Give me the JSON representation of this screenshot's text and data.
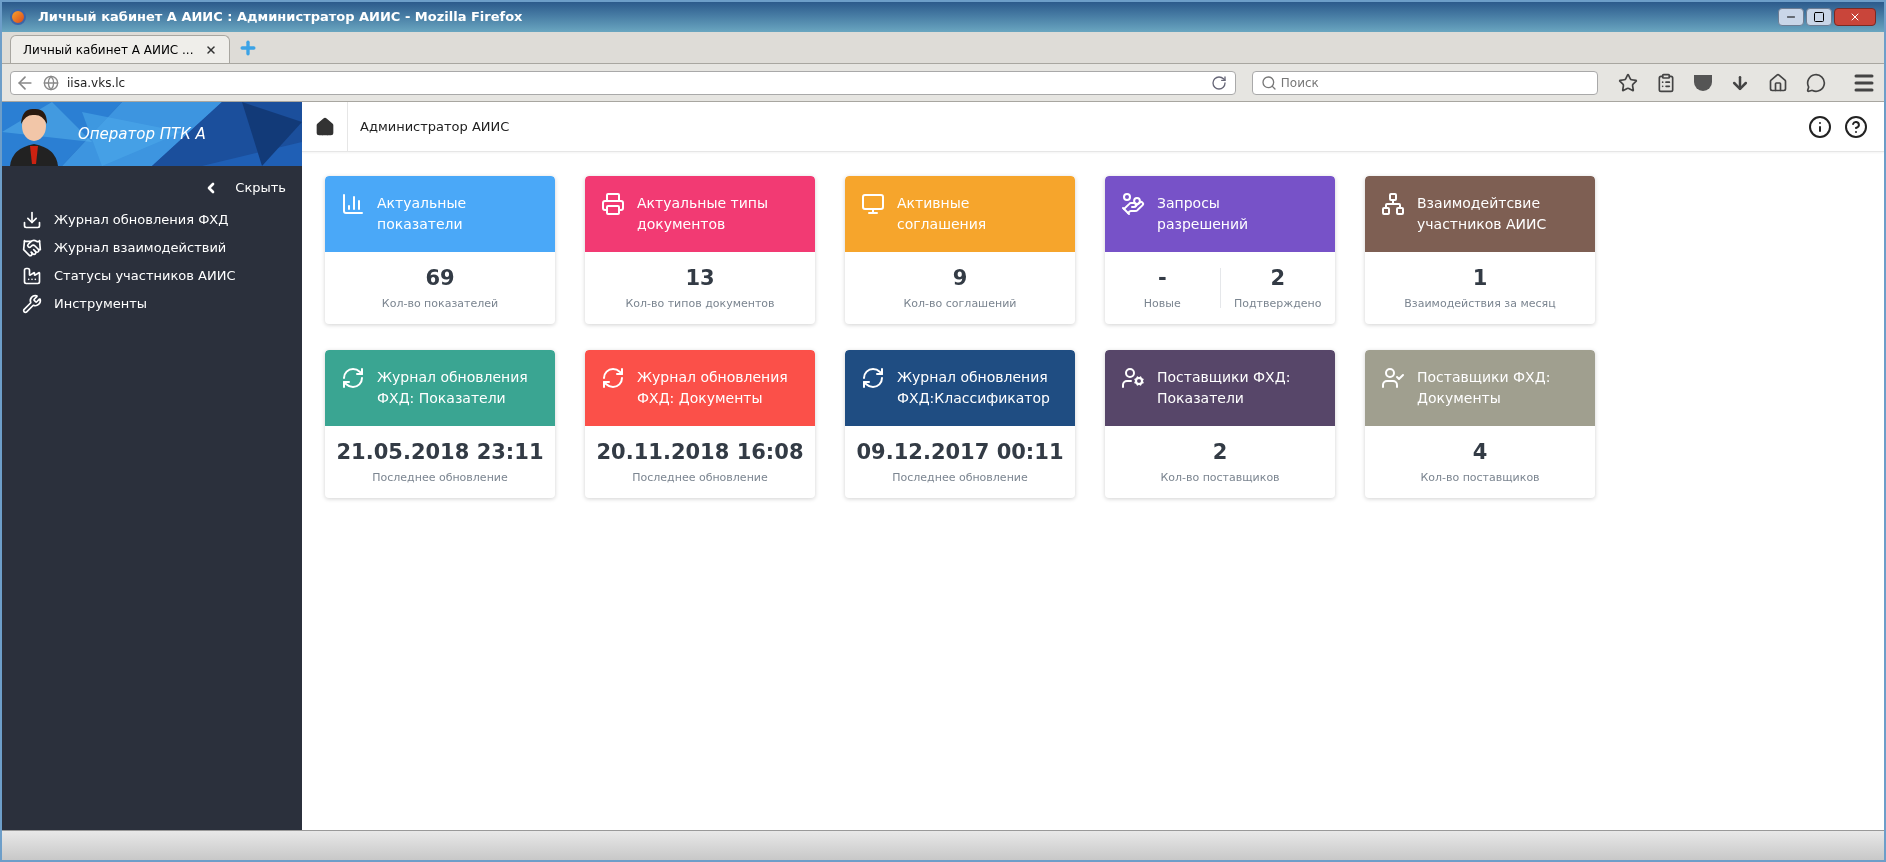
{
  "window": {
    "title": "Личный кабинет А АИИС : Администратор АИИС - Mozilla Firefox"
  },
  "tabs": [
    {
      "label": "Личный кабинет А АИИС ...",
      "selected": true
    }
  ],
  "address_bar": {
    "value": "iisa.vks.lc"
  },
  "search": {
    "placeholder": "Поиск"
  },
  "sidebar": {
    "user": "Оператор ПТК А",
    "hide": "Скрыть",
    "items": [
      {
        "label": "Журнал обновления ФХД"
      },
      {
        "label": "Журнал взаимодействий"
      },
      {
        "label": "Статусы участников АИИС"
      },
      {
        "label": "Инструменты"
      }
    ]
  },
  "header": {
    "title": "Администратор АИИС"
  },
  "cards": [
    {
      "title": [
        "Актуальные",
        "показатели"
      ],
      "color": "#4aa8f8",
      "kind": "single",
      "stats": [
        {
          "value": "69",
          "caption": "Кол-во показателей"
        }
      ]
    },
    {
      "title": [
        "Актуальные типы",
        "документов"
      ],
      "color": "#f23a73",
      "kind": "single",
      "stats": [
        {
          "value": "13",
          "caption": "Кол-во типов документов"
        }
      ]
    },
    {
      "title": [
        "Активные",
        "соглашения"
      ],
      "color": "#f6a52c",
      "kind": "single",
      "stats": [
        {
          "value": "9",
          "caption": "Кол-во соглашений"
        }
      ]
    },
    {
      "title": [
        "Запросы",
        "разрешений"
      ],
      "color": "#7752c8",
      "kind": "split",
      "stats": [
        {
          "value": "-",
          "caption": "Новые"
        },
        {
          "value": "2",
          "caption": "Подтверждено"
        }
      ]
    },
    {
      "title": [
        "Взаимодейтсвие",
        "участников АИИС"
      ],
      "color": "#7e5f53",
      "kind": "single",
      "stats": [
        {
          "value": "1",
          "caption": "Взаимодействия за месяц"
        }
      ]
    },
    {
      "title": [
        "Журнал обновления",
        "ФХД: Показатели"
      ],
      "color": "#3aa592",
      "kind": "single",
      "stats": [
        {
          "value": "21.05.2018 23:11",
          "caption": "Последнее обновление"
        }
      ]
    },
    {
      "title": [
        "Журнал обновления",
        "ФХД: Документы"
      ],
      "color": "#fb5049",
      "kind": "single",
      "stats": [
        {
          "value": "20.11.2018 16:08",
          "caption": "Последнее обновление"
        }
      ]
    },
    {
      "title": [
        "Журнал обновления",
        "ФХД:Классификатор"
      ],
      "color": "#1f4d82",
      "kind": "single",
      "stats": [
        {
          "value": "09.12.2017 00:11",
          "caption": "Последнее обновление"
        }
      ]
    },
    {
      "title": [
        "Поставщики ФХД:",
        "Показатели"
      ],
      "color": "#574669",
      "kind": "single",
      "stats": [
        {
          "value": "2",
          "caption": "Кол-во поставщиков"
        }
      ]
    },
    {
      "title": [
        "Поставщики ФХД:",
        "Документы"
      ],
      "color": "#a09f8f",
      "kind": "single",
      "stats": [
        {
          "value": "4",
          "caption": "Кол-во поставщиков"
        }
      ]
    }
  ]
}
